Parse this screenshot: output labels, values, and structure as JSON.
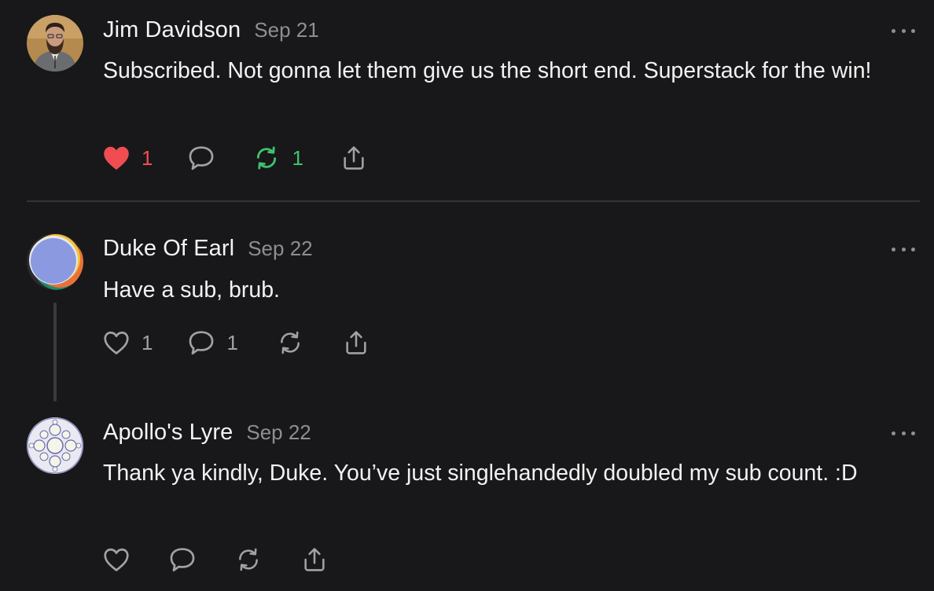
{
  "colors": {
    "background": "#18181a",
    "like_active": "#ef4d51",
    "restack_active": "#3ec46d",
    "icon_default": "#a1a1a6",
    "meta_text": "#8e8e93"
  },
  "comments": [
    {
      "author": "Jim Davidson",
      "date": "Sep 21",
      "text": "Subscribed. Not gonna let them give us the short end. Superstack for the win!",
      "avatar_icon": "person-photo-avatar",
      "likes": "1",
      "liked": true,
      "replies": "",
      "restacks": "1",
      "restacked": true
    },
    {
      "author": "Duke Of Earl",
      "date": "Sep 22",
      "text": "Have a sub, brub.",
      "avatar_icon": "abstract-orb-avatar",
      "likes": "1",
      "liked": false,
      "replies": "1",
      "restacks": "",
      "restacked": false
    },
    {
      "author": "Apollo's Lyre",
      "date": "Sep 22",
      "text": "Thank ya kindly, Duke. You’ve just singlehandedly doubled my sub count. :D",
      "avatar_icon": "fractal-circles-avatar",
      "likes": "",
      "liked": false,
      "replies": "",
      "restacks": "",
      "restacked": false
    }
  ],
  "icons": {
    "like": "heart-icon",
    "reply": "speech-bubble-icon",
    "restack": "restack-icon",
    "share": "share-icon",
    "more": "more-dots-icon"
  }
}
